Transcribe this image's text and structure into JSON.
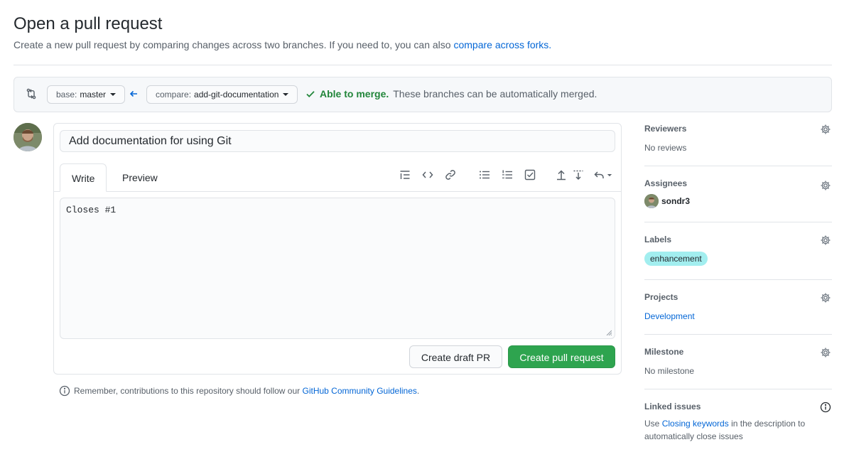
{
  "header": {
    "title": "Open a pull request",
    "subtitle": "Create a new pull request by comparing changes across two branches. If you need to, you can also ",
    "subtitle_link": "compare across forks."
  },
  "compare": {
    "base_prefix": "base:",
    "base_branch": "master",
    "compare_prefix": "compare:",
    "compare_branch": "add-git-documentation",
    "merge_ok": "Able to merge.",
    "merge_text": "These branches can be automatically merged."
  },
  "form": {
    "title_value": "Add documentation for using Git",
    "tabs": [
      "Write",
      "Preview"
    ],
    "body_value": "Closes #1",
    "draft_button": "Create draft PR",
    "create_button": "Create pull request"
  },
  "footer": {
    "note": "Remember, contributions to this repository should follow our ",
    "link": "GitHub Community Guidelines",
    "end": "."
  },
  "sidebar": {
    "reviewers": {
      "heading": "Reviewers",
      "value": "No reviews"
    },
    "assignees": {
      "heading": "Assignees",
      "user": "sondr3"
    },
    "labels": {
      "heading": "Labels",
      "label": "enhancement",
      "label_color": "#a2eeef"
    },
    "projects": {
      "heading": "Projects",
      "value": "Development"
    },
    "milestone": {
      "heading": "Milestone",
      "value": "No milestone"
    },
    "linked_issues": {
      "heading": "Linked issues",
      "prefix": "Use ",
      "link": "Closing keywords",
      "suffix": " in the description to automatically close issues"
    }
  },
  "colors": {
    "primary": "#2ea44f",
    "link": "#0366d6",
    "success": "#22863a"
  }
}
